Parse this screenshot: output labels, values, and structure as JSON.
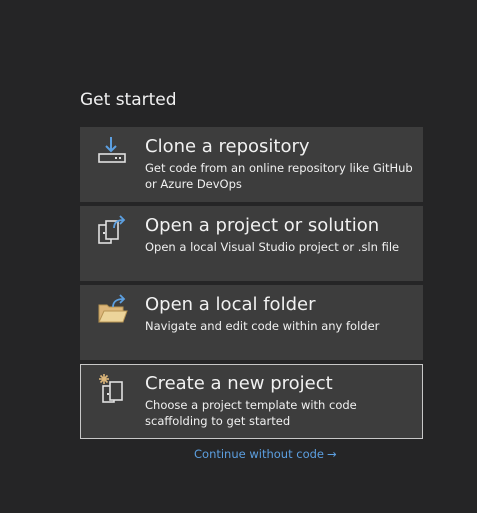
{
  "page": {
    "heading": "Get started"
  },
  "cards": [
    {
      "title": "Clone a repository",
      "description": "Get code from an online repository like GitHub or Azure DevOps",
      "icon": "clone-repository-icon"
    },
    {
      "title": "Open a project or solution",
      "description": "Open a local Visual Studio project or .sln file",
      "icon": "open-project-icon"
    },
    {
      "title": "Open a local folder",
      "description": "Navigate and edit code within any folder",
      "icon": "open-folder-icon"
    },
    {
      "title": "Create a new project",
      "description": "Choose a project template with code scaffolding to get started",
      "icon": "new-project-icon"
    }
  ],
  "continue_link": {
    "label": "Continue without code",
    "arrow": "→"
  },
  "colors": {
    "background": "#252526",
    "card": "#3d3d3d",
    "accent_blue": "#5c9fe0",
    "folder_yellow": "#dcb67a"
  }
}
